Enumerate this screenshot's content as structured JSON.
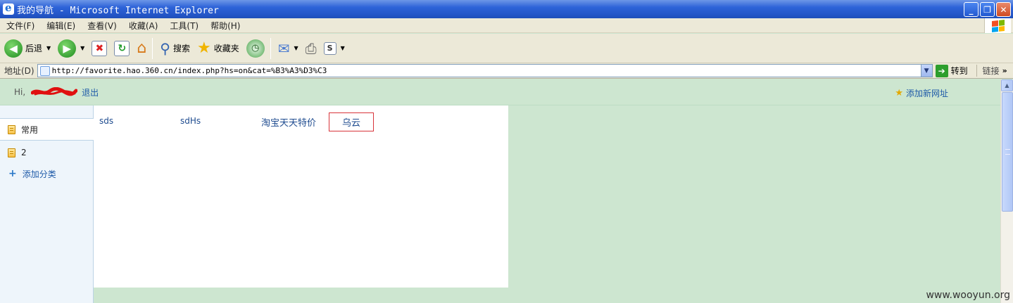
{
  "window": {
    "title": "我的导航 - Microsoft Internet Explorer",
    "controls": {
      "minimize": "_",
      "maximize": "❐",
      "close": "✕"
    }
  },
  "menu": [
    "文件(F)",
    "编辑(E)",
    "查看(V)",
    "收藏(A)",
    "工具(T)",
    "帮助(H)"
  ],
  "toolbar": {
    "back_label": "后退",
    "search_label": "搜索",
    "favorites_label": "收藏夹"
  },
  "address": {
    "label": "地址(D)",
    "url": "http://favorite.hao.360.cn/index.php?hs=on&cat=%B3%A3%D3%C3",
    "go_label": "转到",
    "links_label": "链接",
    "links_more": "»"
  },
  "page": {
    "greeting": "Hi,",
    "logout": "退出",
    "add_url": "添加新网址",
    "sidebar": {
      "items": [
        {
          "label": "常用"
        },
        {
          "label": "2"
        }
      ],
      "add_category": "添加分类"
    },
    "sites": [
      "sds",
      "sdHs",
      "淘宝天天特价",
      "乌云"
    ]
  },
  "watermark": "www.wooyun.org",
  "colors": {
    "page_bg": "#cde6d0",
    "link": "#1e4b8f",
    "highlight_border": "#d8343a",
    "titlebar": "#2456c8"
  }
}
